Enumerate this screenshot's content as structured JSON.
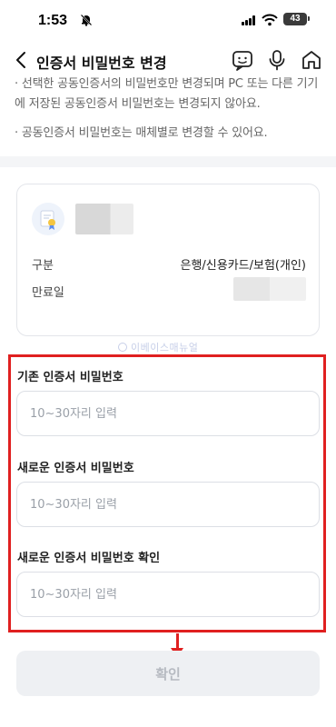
{
  "status_bar": {
    "time": "1:53",
    "battery": "43"
  },
  "header": {
    "title": "인증서 비밀번호 변경"
  },
  "notices": [
    "· 선택한 공동인증서의 비밀번호만 변경되며 PC 또는 다른 기기에 저장된 공동인증서 비밀번호는 변경되지 않아요.",
    "· 공동인증서 비밀번호는 매체별로 변경할 수 있어요."
  ],
  "certificate": {
    "type_label": "구분",
    "type_value": "은행/신용카드/보험(개인)",
    "expiry_label": "만료일"
  },
  "watermark": "이베이스매뉴얼",
  "form": {
    "current_label": "기존 인증서 비밀번호",
    "current_placeholder": "10~30자리 입력",
    "new_label": "새로운 인증서 비밀번호",
    "new_placeholder": "10~30자리 입력",
    "confirm_label": "새로운 인증서 비밀번호 확인",
    "confirm_placeholder": "10~30자리 입력"
  },
  "confirm_button": "확인",
  "colors": {
    "highlight": "#e02020",
    "button_bg": "#eef0f3",
    "button_text": "#b6bac1"
  }
}
